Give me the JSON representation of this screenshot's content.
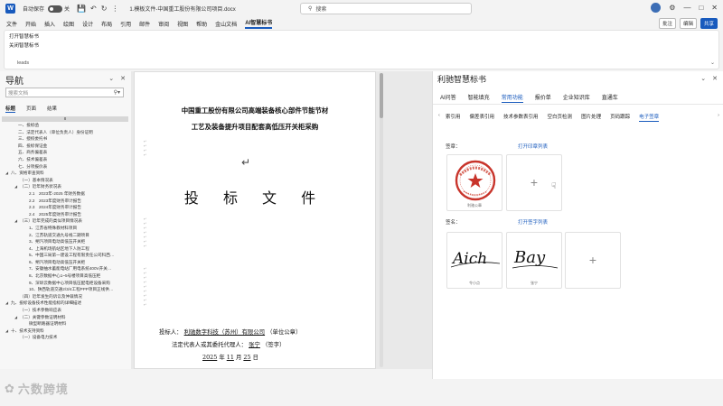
{
  "titlebar": {
    "app_icon": "W",
    "autosave_label": "自动保存",
    "autosave_state": "关",
    "filename": "1.模板文件-中国重工股份有限公司项目.docx",
    "search_placeholder": "搜索",
    "icons": [
      "save-icon",
      "undo-icon",
      "redo-icon",
      "more-icon"
    ]
  },
  "menubar": {
    "items": [
      "文件",
      "开始",
      "插入",
      "绘图",
      "设计",
      "布局",
      "引用",
      "邮件",
      "审阅",
      "视图",
      "帮助",
      "金山文档",
      "AI智慧标书"
    ],
    "active": "AI智慧标书",
    "comment_label": "批注",
    "edit_label": "编辑",
    "share_label": "共享"
  },
  "ribbon": {
    "open_label": "打开智慧标书",
    "close_label": "关闭智慧标书",
    "group_label": "leads"
  },
  "nav": {
    "title": "导航",
    "search_placeholder": "搜索文档",
    "tabs": [
      "标题",
      "页面",
      "结果"
    ],
    "active_tab": "标题",
    "selected": "8",
    "items": [
      {
        "level": 1,
        "text": "一、投标函"
      },
      {
        "level": 1,
        "text": "二、法定代表人（单位负责人）身份证明"
      },
      {
        "level": 1,
        "text": "三、授权委托书"
      },
      {
        "level": 1,
        "text": "四、投标保证金"
      },
      {
        "level": 1,
        "text": "五、商务偏差表"
      },
      {
        "level": 1,
        "text": "六、技术偏差表"
      },
      {
        "level": 1,
        "text": "七、分项报价表"
      },
      {
        "level": 0,
        "text": "八、资格审查资料",
        "expand": true
      },
      {
        "level": 2,
        "text": "（一）基本情况表"
      },
      {
        "level": 2,
        "text": "（二）近年财务状况表",
        "expand": true
      },
      {
        "level": 3,
        "text": "2.1　2023年-2025 年财务数据"
      },
      {
        "level": 3,
        "text": "2.2　2023年度财务审计报告"
      },
      {
        "level": 3,
        "text": "2.3　2024年度财务审计报告"
      },
      {
        "level": 3,
        "text": "2.4　2025年度财务审计报告"
      },
      {
        "level": 2,
        "text": "（三）近年完成的类似项目情况表",
        "expand": true
      },
      {
        "level": 3,
        "text": "1、江苏省特殊教材科项目"
      },
      {
        "level": 3,
        "text": "2、江苏轨道交通九号线二期项目"
      },
      {
        "level": 3,
        "text": "3、朔汽项目电动高低压开关柜"
      },
      {
        "level": 3,
        "text": "4、上海机场航站区地下人防工程"
      },
      {
        "level": 3,
        "text": "5、中国三局第一建设工程有限责任公司科西…"
      },
      {
        "level": 3,
        "text": "6、朔汽项目电动高低压开关柜"
      },
      {
        "level": 3,
        "text": "7、安徽抽水蓄能电站厂用电系统400V开关…"
      },
      {
        "level": 3,
        "text": "8、北京数据中心1~5号楼项目高低压柜"
      },
      {
        "level": 3,
        "text": "9、深圳云数据中心项目低压配电柜设备采购"
      },
      {
        "level": 3,
        "text": "10、陕西轨道交通2/3/4工程PPP项目正线供…"
      },
      {
        "level": 2,
        "text": "（四）近年发生的诉讼及仲裁情况"
      },
      {
        "level": 0,
        "text": "九、投标设备技术性能指标的详细描述",
        "expand": true
      },
      {
        "level": 2,
        "text": "（一）技术参数响应表"
      },
      {
        "level": 2,
        "text": "（二）关键参数证明材料",
        "expand": true
      },
      {
        "level": 3,
        "text": "微型断路器证明材料"
      },
      {
        "level": 0,
        "text": "十、技术支持资料",
        "expand": true
      },
      {
        "level": 2,
        "text": "（一）设备电力技术"
      }
    ]
  },
  "document": {
    "title_line1": "中国重工股份有限公司高端装备核心部件节能节材",
    "title_line2": "工艺及装备提升项目配套高低压开关柜采购",
    "main_title": "投 标 文 件",
    "bidder_label": "投标人：",
    "bidder_name": "利驰数字科技（苏州）有限公司",
    "bidder_suffix": "（单位公章）",
    "legal_label": "法定代表人或其委托代理人：",
    "legal_name": "张宁",
    "legal_suffix": "（签字）",
    "date_year": "2025",
    "date_month": "11",
    "date_day": "25",
    "date_year_unit": "年",
    "date_month_unit": "月",
    "date_day_unit": "日",
    "return_mark": "↵"
  },
  "panel": {
    "title": "利驰智慧标书",
    "tabs": [
      "AI问答",
      "智能填充",
      "常用功能",
      "报价单",
      "企业知识库",
      "直通车"
    ],
    "active_tab": "常用功能",
    "subtabs": [
      "索引用",
      "偏差表引用",
      "技术参数表引用",
      "空白页检测",
      "图片处理",
      "页码跟踪",
      "电子签章"
    ],
    "active_subtab": "电子签章",
    "seal_section": {
      "label": "签章：",
      "link": "打开印章列表",
      "seal_caption": "利驰公章"
    },
    "sign_section": {
      "label": "签名：",
      "link": "打开签字列表",
      "sign1_caption": "令小点",
      "sign2_caption": "张宁",
      "sign1_text": "Aich",
      "sign2_text": "Bay"
    },
    "plus_symbol": "+"
  },
  "watermark": {
    "text": "六数跨境"
  }
}
